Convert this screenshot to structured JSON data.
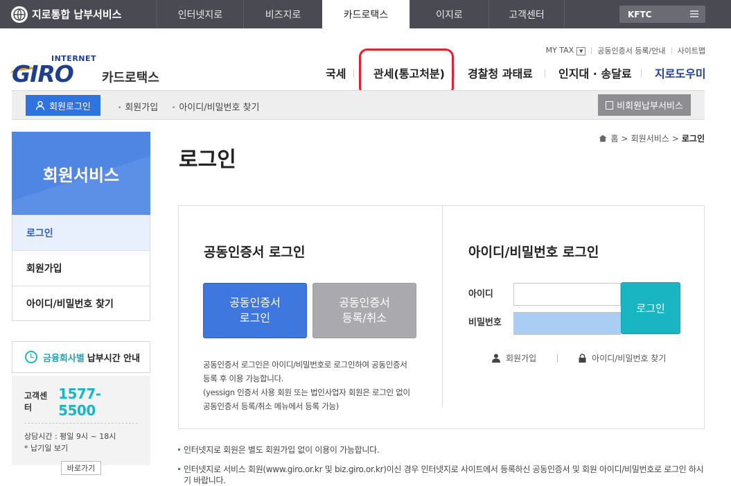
{
  "topbar": {
    "brand": "지로통합 납부서비스",
    "tabs": [
      "인터넷지로",
      "비즈지로",
      "카드로택스",
      "이지로",
      "고객센터"
    ],
    "active_tab": "카드로택스",
    "kftc": "KFTC"
  },
  "logo": {
    "internet": "INTERNET",
    "giro": "GIRO",
    "subtitle": "카드로택스"
  },
  "util": {
    "mytax": "MY TAX",
    "cert_register": "공동인증서 등록/안내",
    "sitemap": "사이트맵"
  },
  "mainnav": {
    "items": [
      "국세",
      "관세(통고처분)",
      "경찰청 과태료",
      "인지대 · 송달료",
      "지로도우미"
    ]
  },
  "subbar": {
    "login": "회원로그인",
    "join": "회원가입",
    "find": "아이디/비밀번호 찾기",
    "nonmember": "비회원납부서비스"
  },
  "sidebar": {
    "title": "회원서비스",
    "items": [
      "로그인",
      "회원가입",
      "아이디/비밀번호 찾기"
    ],
    "fin_highlight": "금융회사별",
    "fin_rest": "납부시간 안내",
    "cust_label": "고객센터",
    "cust_phone": "1577-5500",
    "cust_hours": "상담시간 : 평일 9시 ~ 18시",
    "cust_note": "* 납기일 보기",
    "cust_go": "바로가기"
  },
  "breadcrumb": {
    "home": "홈",
    "sep1": ">",
    "level1": "회원서비스",
    "sep2": ">",
    "current": "로그인"
  },
  "page_title": "로그인",
  "cert": {
    "title": "공동인증서 로그인",
    "login_line1": "공동인증서",
    "login_line2": "로그인",
    "reg_line1": "공동인증서",
    "reg_line2": "등록/취소",
    "desc1": "공동인증서 로그인은 아이디/비밀번호로 로그인하여 공동인증서 등록 후 이용 가능합니다.",
    "desc2": "(yessign 인증서 사용 회원 또는 법인사업자 회원은 로그인 없이 공동인증서 등록/취소 메뉴에서 등록 가능)"
  },
  "idlogin": {
    "title": "아이디/비밀번호 로그인",
    "id_label": "아이디",
    "pw_label": "비밀번호",
    "id_value": "",
    "pw_value": "",
    "button": "로그인",
    "join": "회원가입",
    "find": "아이디/비밀번호 찾기"
  },
  "notes": [
    "인터넷지로 회원은 별도 회원가입 없이 이용이 가능합니다.",
    "인터넷지로 서비스 회원(www.giro.or.kr 및 biz.giro.or.kr)이신 경우 인터넷지로 사이트에서 등록하신 공동인증서 및 회원 아이디/비밀번호로 로그인 하시기 바랍니다."
  ],
  "colors": {
    "topbar": "#4a4a52",
    "primary_blue": "#3e78de",
    "teal": "#19b5c2",
    "highlight_red": "#e5202a"
  }
}
